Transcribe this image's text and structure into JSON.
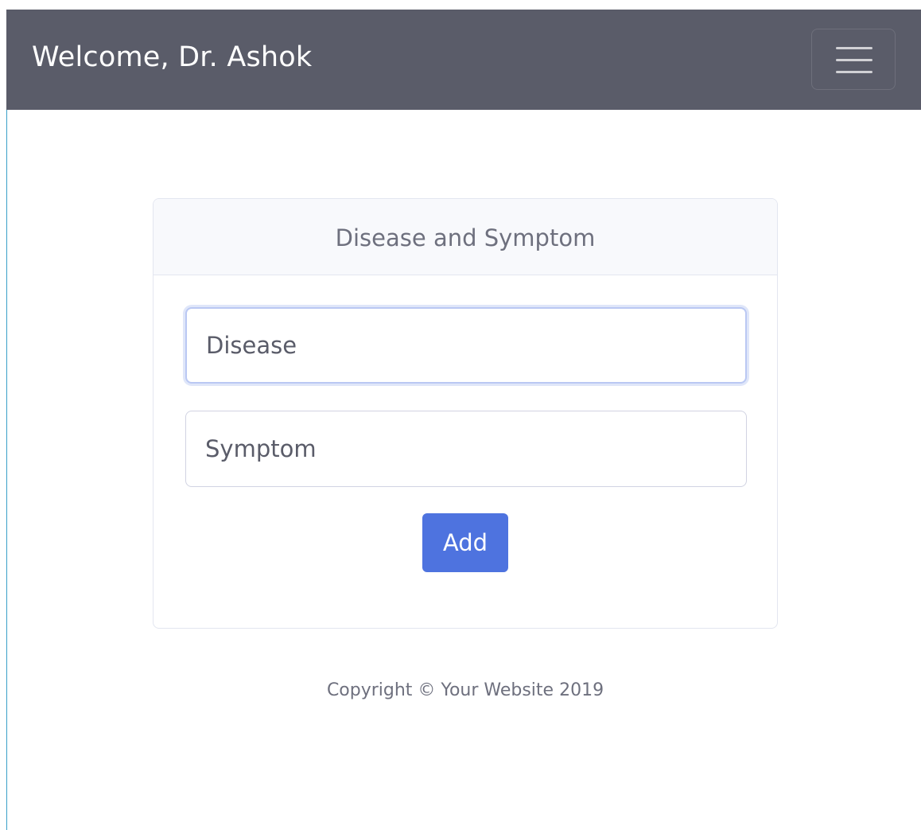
{
  "navbar": {
    "brand": "Welcome, Dr. Ashok",
    "toggle_icon": "hamburger-icon",
    "background": "#5a5c69"
  },
  "card": {
    "title": "Disease and Symptom",
    "disease_field": {
      "placeholder": "Disease",
      "value": ""
    },
    "symptom_field": {
      "placeholder": "Symptom",
      "value": ""
    },
    "add_label": "Add",
    "add_color": "#4e73df"
  },
  "footer": {
    "text": "Copyright © Your Website 2019"
  }
}
